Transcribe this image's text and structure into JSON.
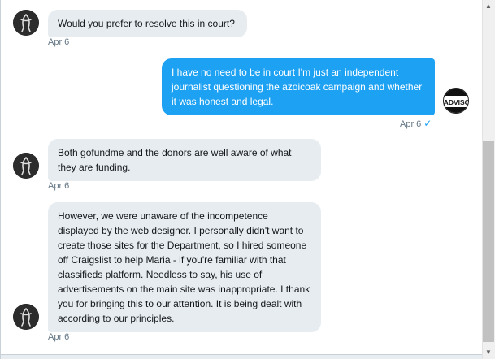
{
  "conversation": {
    "messages": [
      {
        "side": "in",
        "text": "Would you prefer to resolve this in court?",
        "time": "Apr 6"
      },
      {
        "side": "out",
        "text": "I have no need to be in court I'm just an independent journalist questioning the azoicoak campaign and whether it was honest and legal.",
        "time": "Apr 6"
      },
      {
        "side": "in",
        "text": "Both gofundme and the donors are well aware of what they are funding.",
        "time": "Apr 6"
      },
      {
        "side": "in",
        "text": "However, we were unaware of the incompetence displayed by the web designer. I personally didn't want to create those sites for the Department, so I hired someone off Craigslist to help Maria - if you're familiar with that classifieds platform. Needless to say, his use of advertisements on the main site was inappropriate. I thank you for bringing this to our attention. It is being dealt with according to our principles.",
        "time": "Apr 6"
      }
    ],
    "read_icon": "check-icon",
    "right_avatar_text": "ADVISO"
  },
  "colors": {
    "accent": "#1da1f2",
    "incoming_bubble": "#e6ecf0",
    "timestamp": "#657786"
  }
}
